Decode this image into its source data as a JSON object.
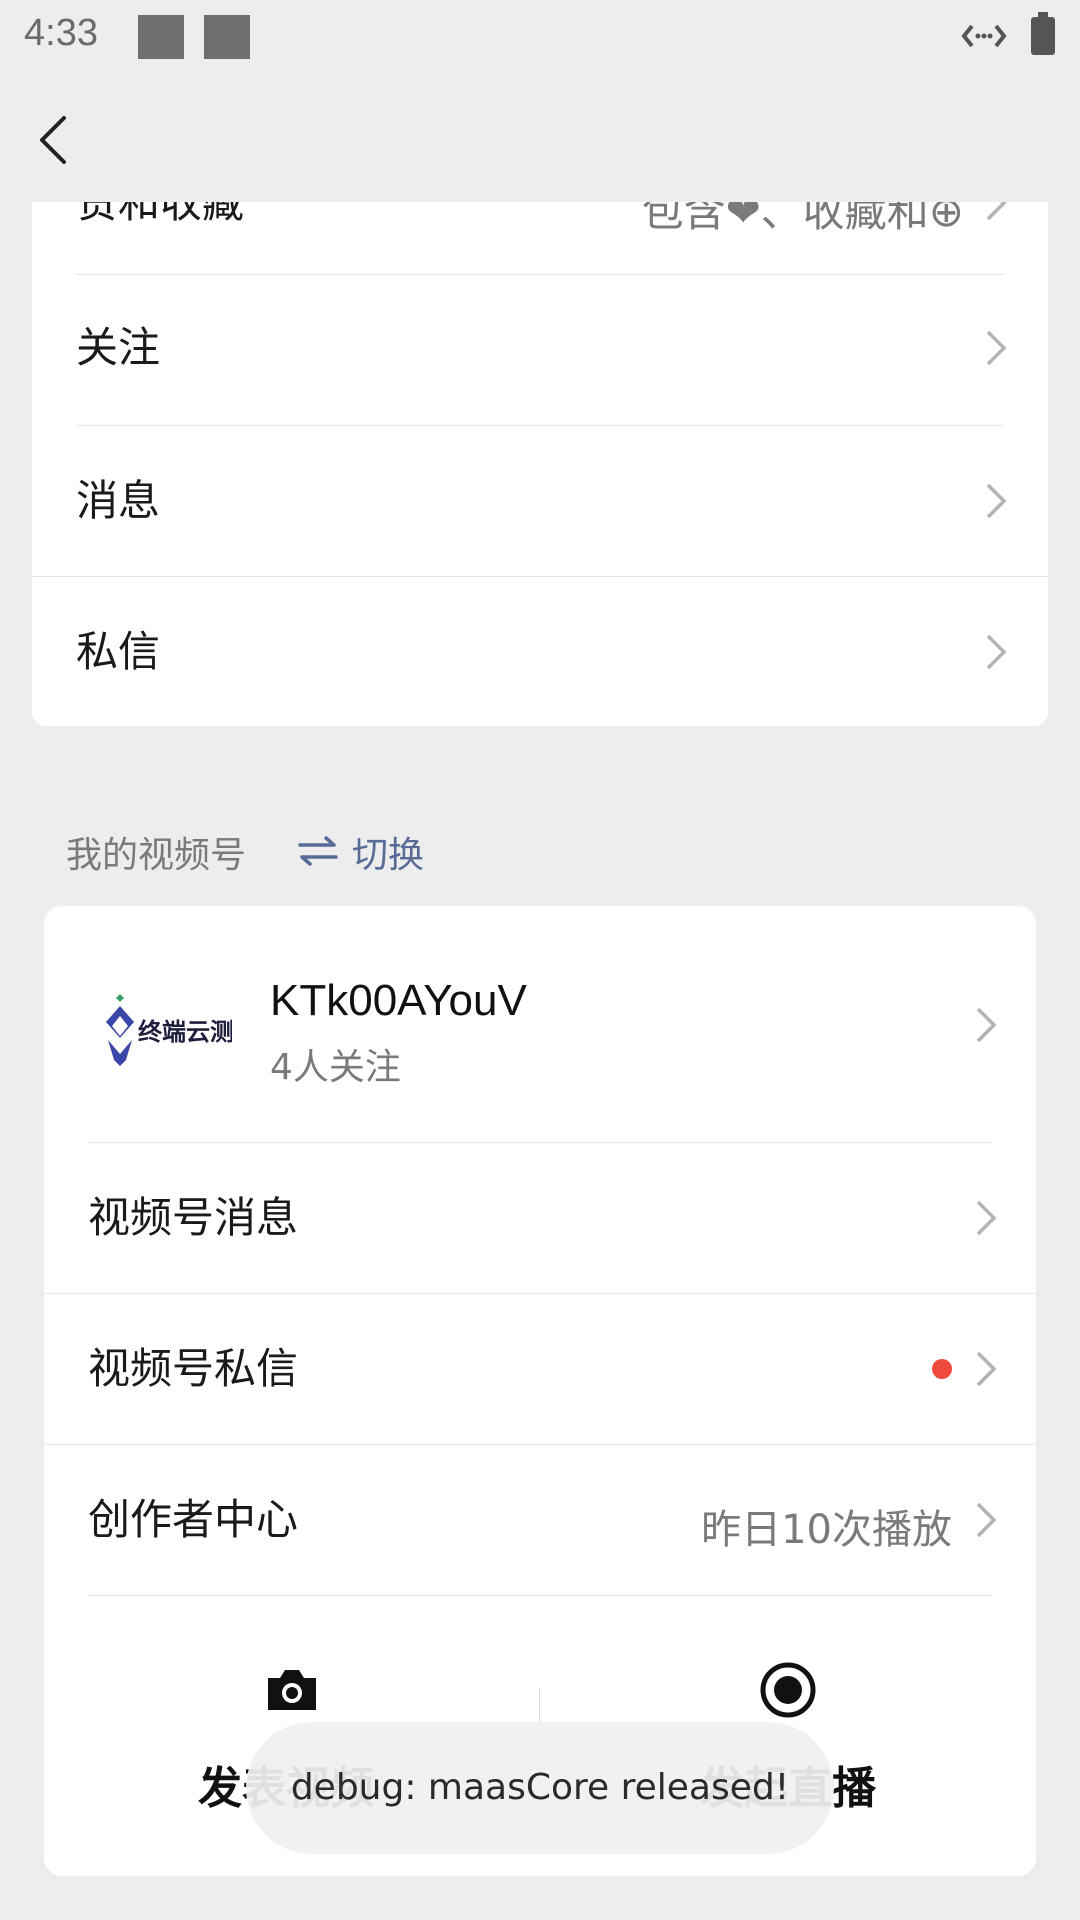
{
  "status_bar": {
    "time": "4:33"
  },
  "top_list": {
    "partial_row": {
      "label": "赞和收藏",
      "value": "包含❤、收藏和⊕"
    },
    "rows": [
      {
        "label": "关注"
      },
      {
        "label": "消息"
      },
      {
        "label": "私信"
      }
    ]
  },
  "video_section": {
    "title": "我的视频号",
    "switch_label": "切换",
    "account": {
      "name": "KTk00AYouV",
      "followers": "4人关注",
      "logo_text": "终端云测"
    },
    "rows": [
      {
        "label": "视频号消息"
      },
      {
        "label": "视频号私信"
      },
      {
        "label": "创作者中心",
        "value": "昨日10次播放"
      }
    ],
    "actions": {
      "post_video": "发表视频",
      "start_live": "发起直播"
    }
  },
  "toast": {
    "text": "debug: maasCore released!"
  },
  "colors": {
    "accent": "#576b95",
    "badge_red": "#f04a3c",
    "background": "#ededed",
    "card": "#ffffff"
  }
}
